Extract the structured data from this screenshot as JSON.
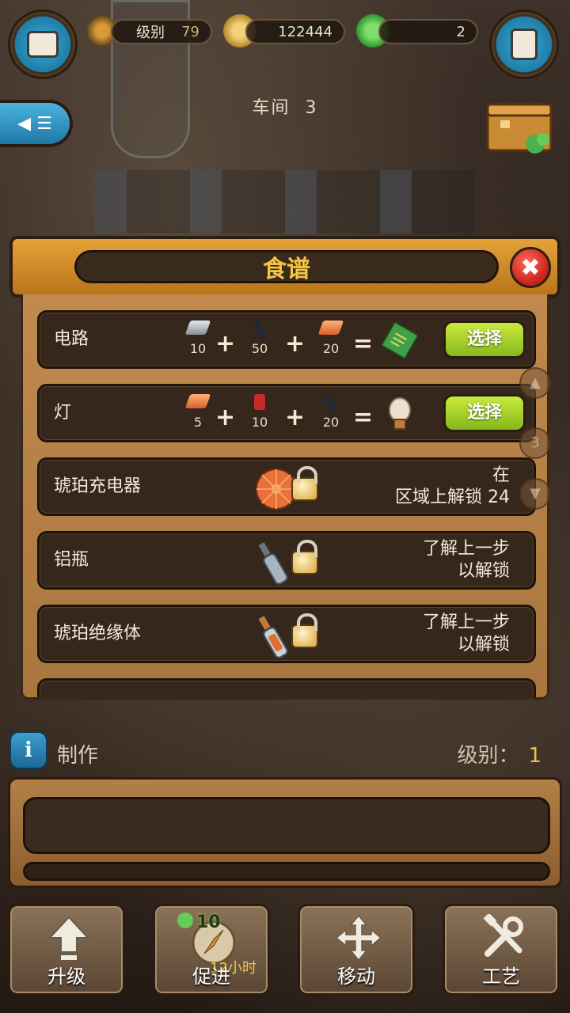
{
  "top_bar": {
    "level_label": "级别",
    "level_value": "79",
    "coins": "122444",
    "gems": "2",
    "left_icon": "toolbox-icon",
    "right_icon": "clipboard-icon"
  },
  "workshop": {
    "label": "车间",
    "number": "3"
  },
  "recipes": {
    "title": "食谱",
    "select_label": "选择",
    "rows": [
      {
        "name": "电路",
        "ingredients": [
          {
            "icon": "iron-ingot-icon",
            "qty": "10"
          },
          {
            "icon": "rod-icon",
            "qty": "50"
          },
          {
            "icon": "copper-ingot-icon",
            "qty": "20"
          }
        ],
        "result_icon": "circuit-board-icon"
      },
      {
        "name": "灯",
        "ingredients": [
          {
            "icon": "copper-ingot-icon",
            "qty": "5"
          },
          {
            "icon": "spool-icon",
            "qty": "10"
          },
          {
            "icon": "rod-icon",
            "qty": "20"
          }
        ],
        "result_icon": "light-bulb-icon"
      },
      {
        "name": "琥珀充电器",
        "locked": true,
        "result_icon": "amber-charger-icon",
        "unlock_line1": "在",
        "unlock_line2": "区域上解锁 24"
      },
      {
        "name": "铝瓶",
        "locked": true,
        "result_icon": "aluminum-bottle-icon",
        "unlock_line1": "了解上一步",
        "unlock_line2": "以解锁"
      },
      {
        "name": "琥珀绝缘体",
        "locked": true,
        "result_icon": "amber-insulator-icon",
        "unlock_line1": "了解上一步",
        "unlock_line2": "以解锁"
      }
    ]
  },
  "side_controls": {
    "page_number": "3"
  },
  "craft": {
    "label": "制作",
    "level_label": "级别：",
    "level_value": "1"
  },
  "bottom_bar": {
    "upgrade": "升级",
    "boost": "促进",
    "boost_cost": "10",
    "boost_time": "12小时",
    "move": "移动",
    "craft": "工艺"
  },
  "colors": {
    "accent_orange": "#e4a23a",
    "select_green": "#a6d42a",
    "gold_text": "#f2c640",
    "close_red": "#d8281f"
  }
}
